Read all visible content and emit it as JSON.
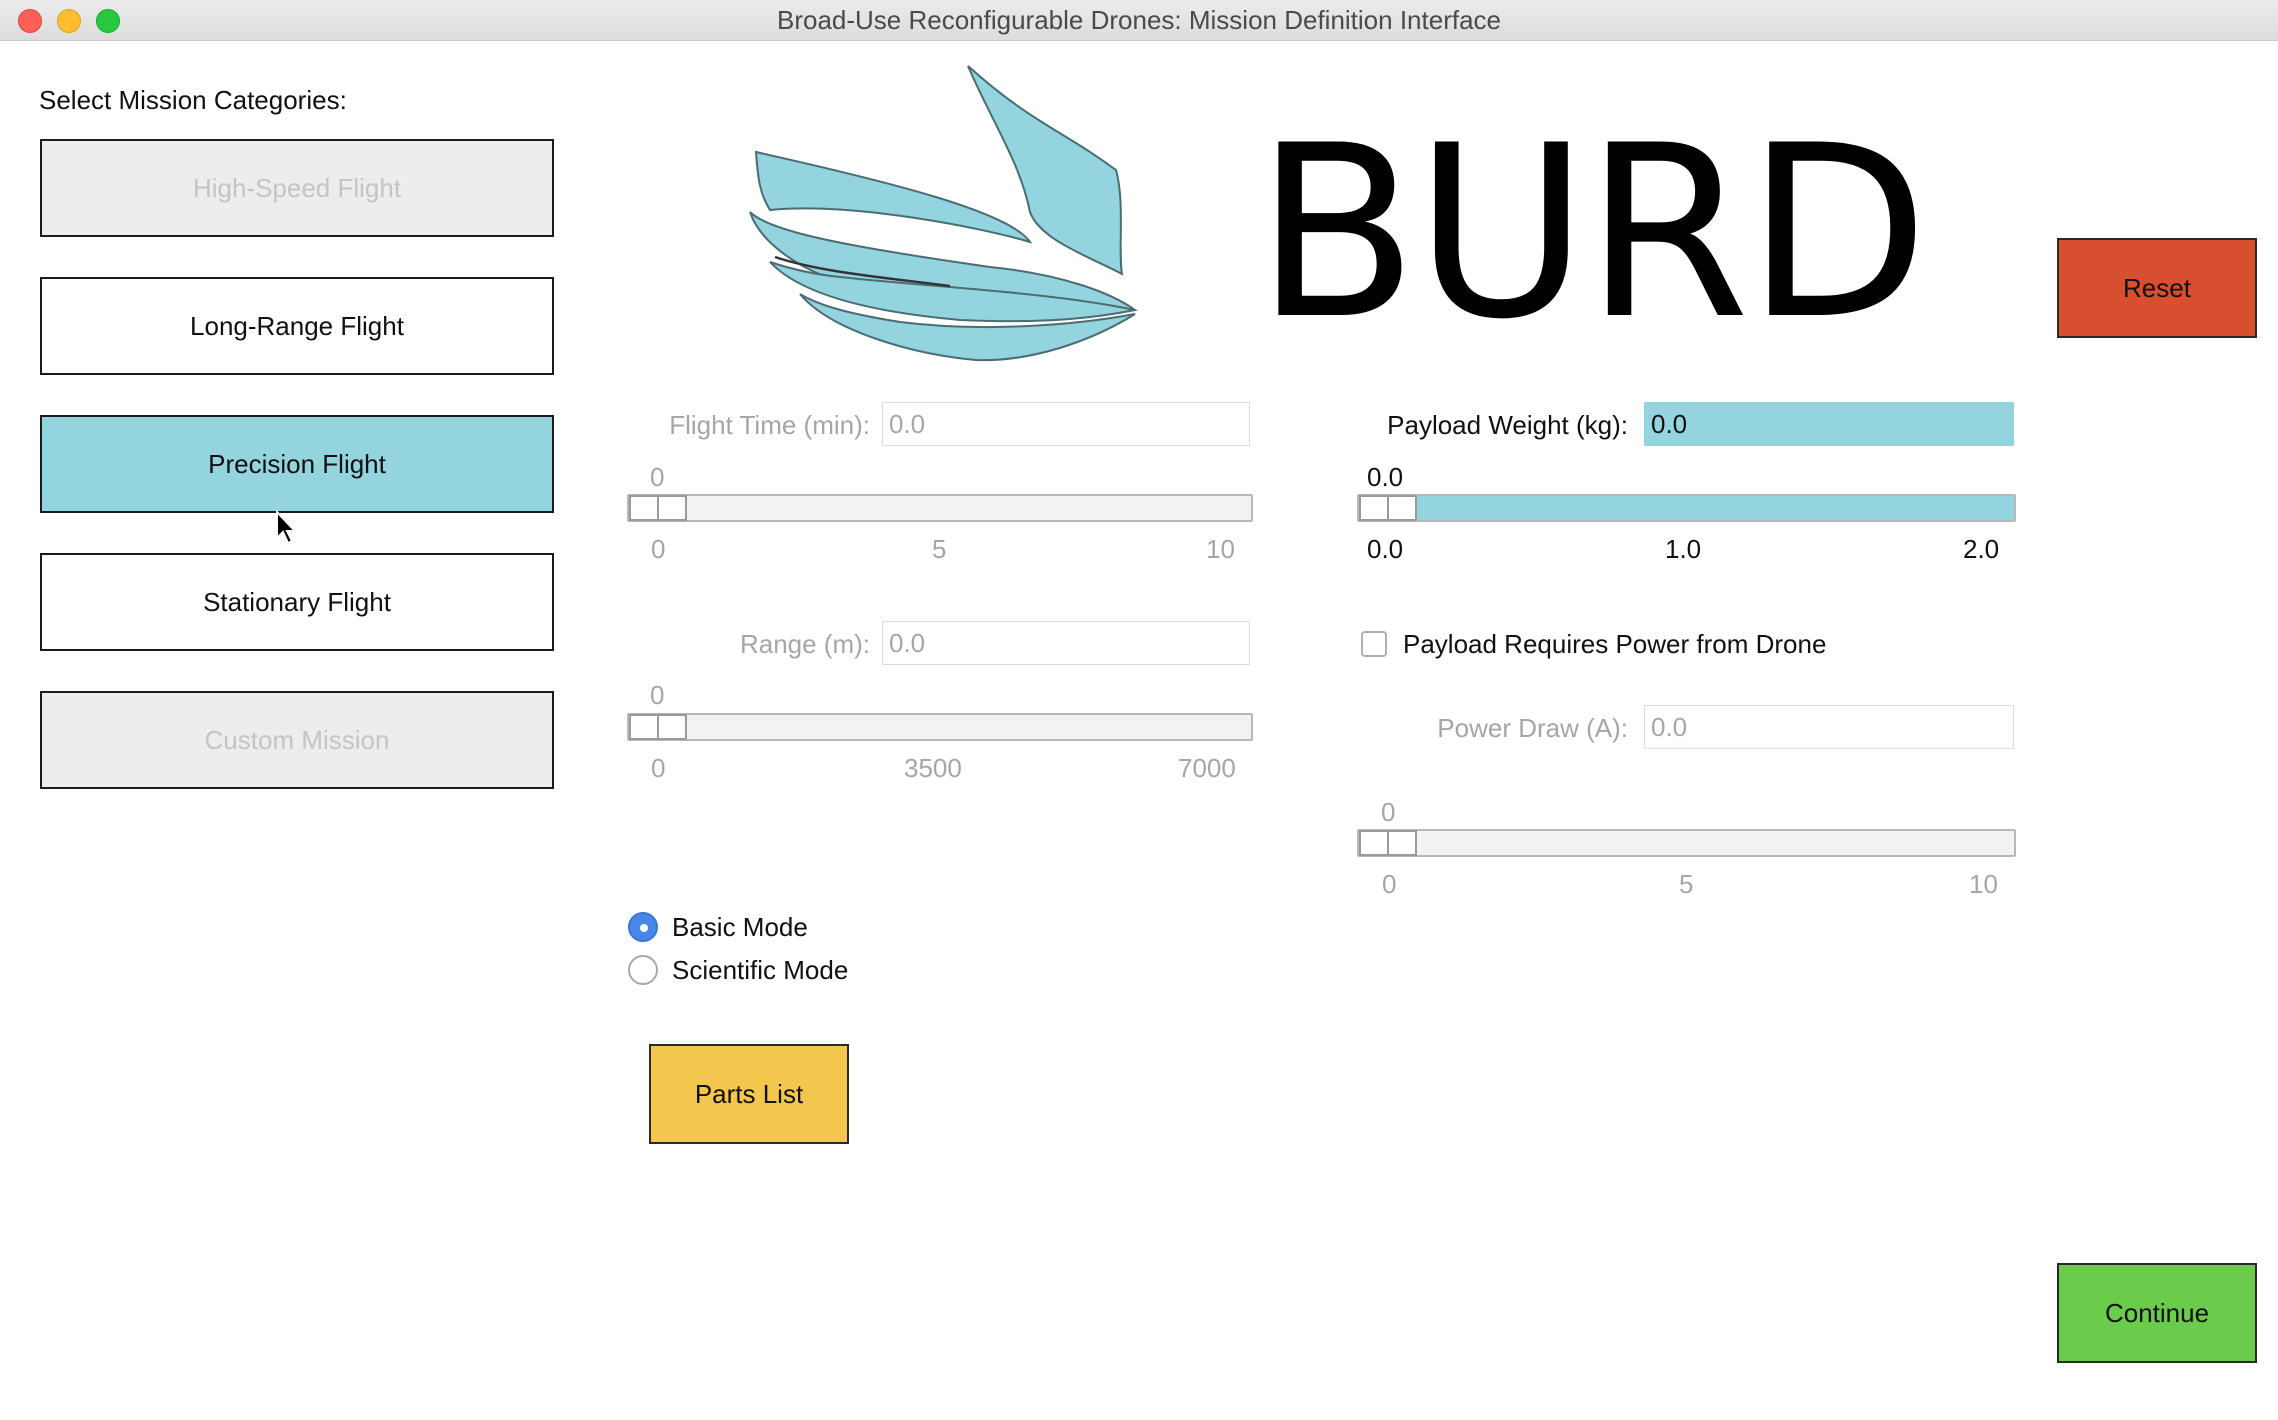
{
  "window": {
    "title": "Broad-Use Reconfigurable Drones: Mission Definition Interface"
  },
  "categories": {
    "heading": "Select Mission Categories:",
    "items": [
      {
        "label": "High-Speed Flight",
        "state": "disabled"
      },
      {
        "label": "Long-Range Flight",
        "state": "enabled"
      },
      {
        "label": "Precision Flight",
        "state": "selected"
      },
      {
        "label": "Stationary Flight",
        "state": "enabled"
      },
      {
        "label": "Custom Mission",
        "state": "disabled"
      }
    ]
  },
  "logo": {
    "text": "BURD",
    "wing_color": "#94d4de"
  },
  "reset_label": "Reset",
  "continue_label": "Continue",
  "parts_list_label": "Parts List",
  "flight_time": {
    "label": "Flight Time (min):",
    "value": "0.0",
    "slider_value": "0",
    "ticks": [
      "0",
      "5",
      "10"
    ],
    "level": 0
  },
  "range": {
    "label": "Range (m):",
    "value": "0.0",
    "slider_value": "0",
    "ticks": [
      "0",
      "3500",
      "7000"
    ],
    "level": 0
  },
  "payload_weight": {
    "label": "Payload Weight (kg):",
    "value": "0.0",
    "slider_value": "0.0",
    "ticks": [
      "0.0",
      "1.0",
      "2.0"
    ],
    "level": 0
  },
  "payload_power": {
    "label": "Payload Requires Power from Drone",
    "checked": false
  },
  "power_draw": {
    "label": "Power Draw (A):",
    "value": "0.0",
    "slider_value": "0",
    "ticks": [
      "0",
      "5",
      "10"
    ],
    "level": 0
  },
  "modes": [
    {
      "label": "Basic Mode",
      "checked": true
    },
    {
      "label": "Scientific Mode",
      "checked": false
    }
  ],
  "colors": {
    "accent": "#94d4de",
    "reset": "#d84f2f",
    "continue": "#6bcb4b",
    "parts": "#f3c64e"
  }
}
